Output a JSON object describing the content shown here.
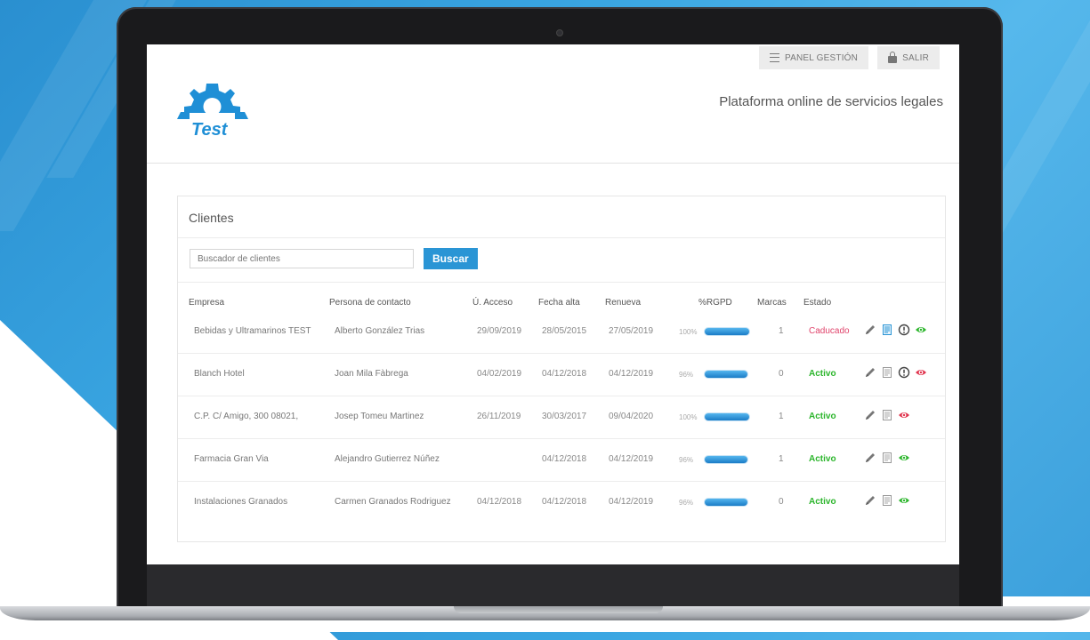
{
  "header": {
    "panel_label": "PANEL GESTIÓN",
    "logout_label": "SALIR",
    "logo_text": "Test",
    "tagline": "Plataforma online de servicios legales"
  },
  "clients": {
    "title": "Clientes",
    "search": {
      "placeholder": "Buscador de clientes",
      "button_label": "Buscar"
    },
    "columns": [
      "Empresa",
      "Persona de contacto",
      "Ú. Acceso",
      "Fecha alta",
      "Renueva",
      "%RGPD",
      "Marcas",
      "Estado"
    ],
    "rows": [
      {
        "empresa": "Bebidas y Ultramarinos TEST",
        "contacto": "Alberto González Trias",
        "acceso": "29/09/2019",
        "alta": "28/05/2015",
        "renueva": "27/05/2019",
        "rgpd_label": "100%",
        "rgpd": 100,
        "marcas": "1",
        "estado": "Caducado",
        "icons": [
          "pencil-icon",
          "document-icon-blue",
          "alert-icon",
          "eye-icon-green"
        ]
      },
      {
        "empresa": "Blanch Hotel",
        "contacto": "Joan Mila Fàbrega",
        "acceso": "04/02/2019",
        "alta": "04/12/2018",
        "renueva": "04/12/2019",
        "rgpd_label": "96%",
        "rgpd": 96,
        "marcas": "0",
        "estado": "Activo",
        "icons": [
          "pencil-icon",
          "document-icon",
          "alert-icon",
          "eye-icon-red"
        ]
      },
      {
        "empresa": "C.P. C/ Amigo, 300 08021,",
        "contacto": "Josep Tomeu Martinez",
        "acceso": "26/11/2019",
        "alta": "30/03/2017",
        "renueva": "09/04/2020",
        "rgpd_label": "100%",
        "rgpd": 100,
        "marcas": "1",
        "estado": "Activo",
        "icons": [
          "pencil-icon",
          "document-icon",
          "eye-icon-red"
        ]
      },
      {
        "empresa": "Farmacia Gran Via",
        "contacto": "Alejandro Gutierrez Núñez",
        "acceso": "",
        "alta": "04/12/2018",
        "renueva": "04/12/2019",
        "rgpd_label": "96%",
        "rgpd": 96,
        "marcas": "1",
        "estado": "Activo",
        "icons": [
          "pencil-icon",
          "document-icon",
          "eye-icon-green"
        ]
      },
      {
        "empresa": "Instalaciones Granados",
        "contacto": "Carmen Granados Rodriguez",
        "acceso": "04/12/2018",
        "alta": "04/12/2018",
        "renueva": "04/12/2019",
        "rgpd_label": "96%",
        "rgpd": 96,
        "marcas": "0",
        "estado": "Activo",
        "icons": [
          "pencil-icon",
          "document-icon",
          "eye-icon-green"
        ]
      }
    ]
  },
  "colors": {
    "accent": "#2a95d5",
    "logo_blue": "#1f8fd6",
    "status_expired": "#e0436b",
    "status_active": "#2bb52b",
    "eye_green": "#2bb52b",
    "eye_red": "#e0334d"
  }
}
